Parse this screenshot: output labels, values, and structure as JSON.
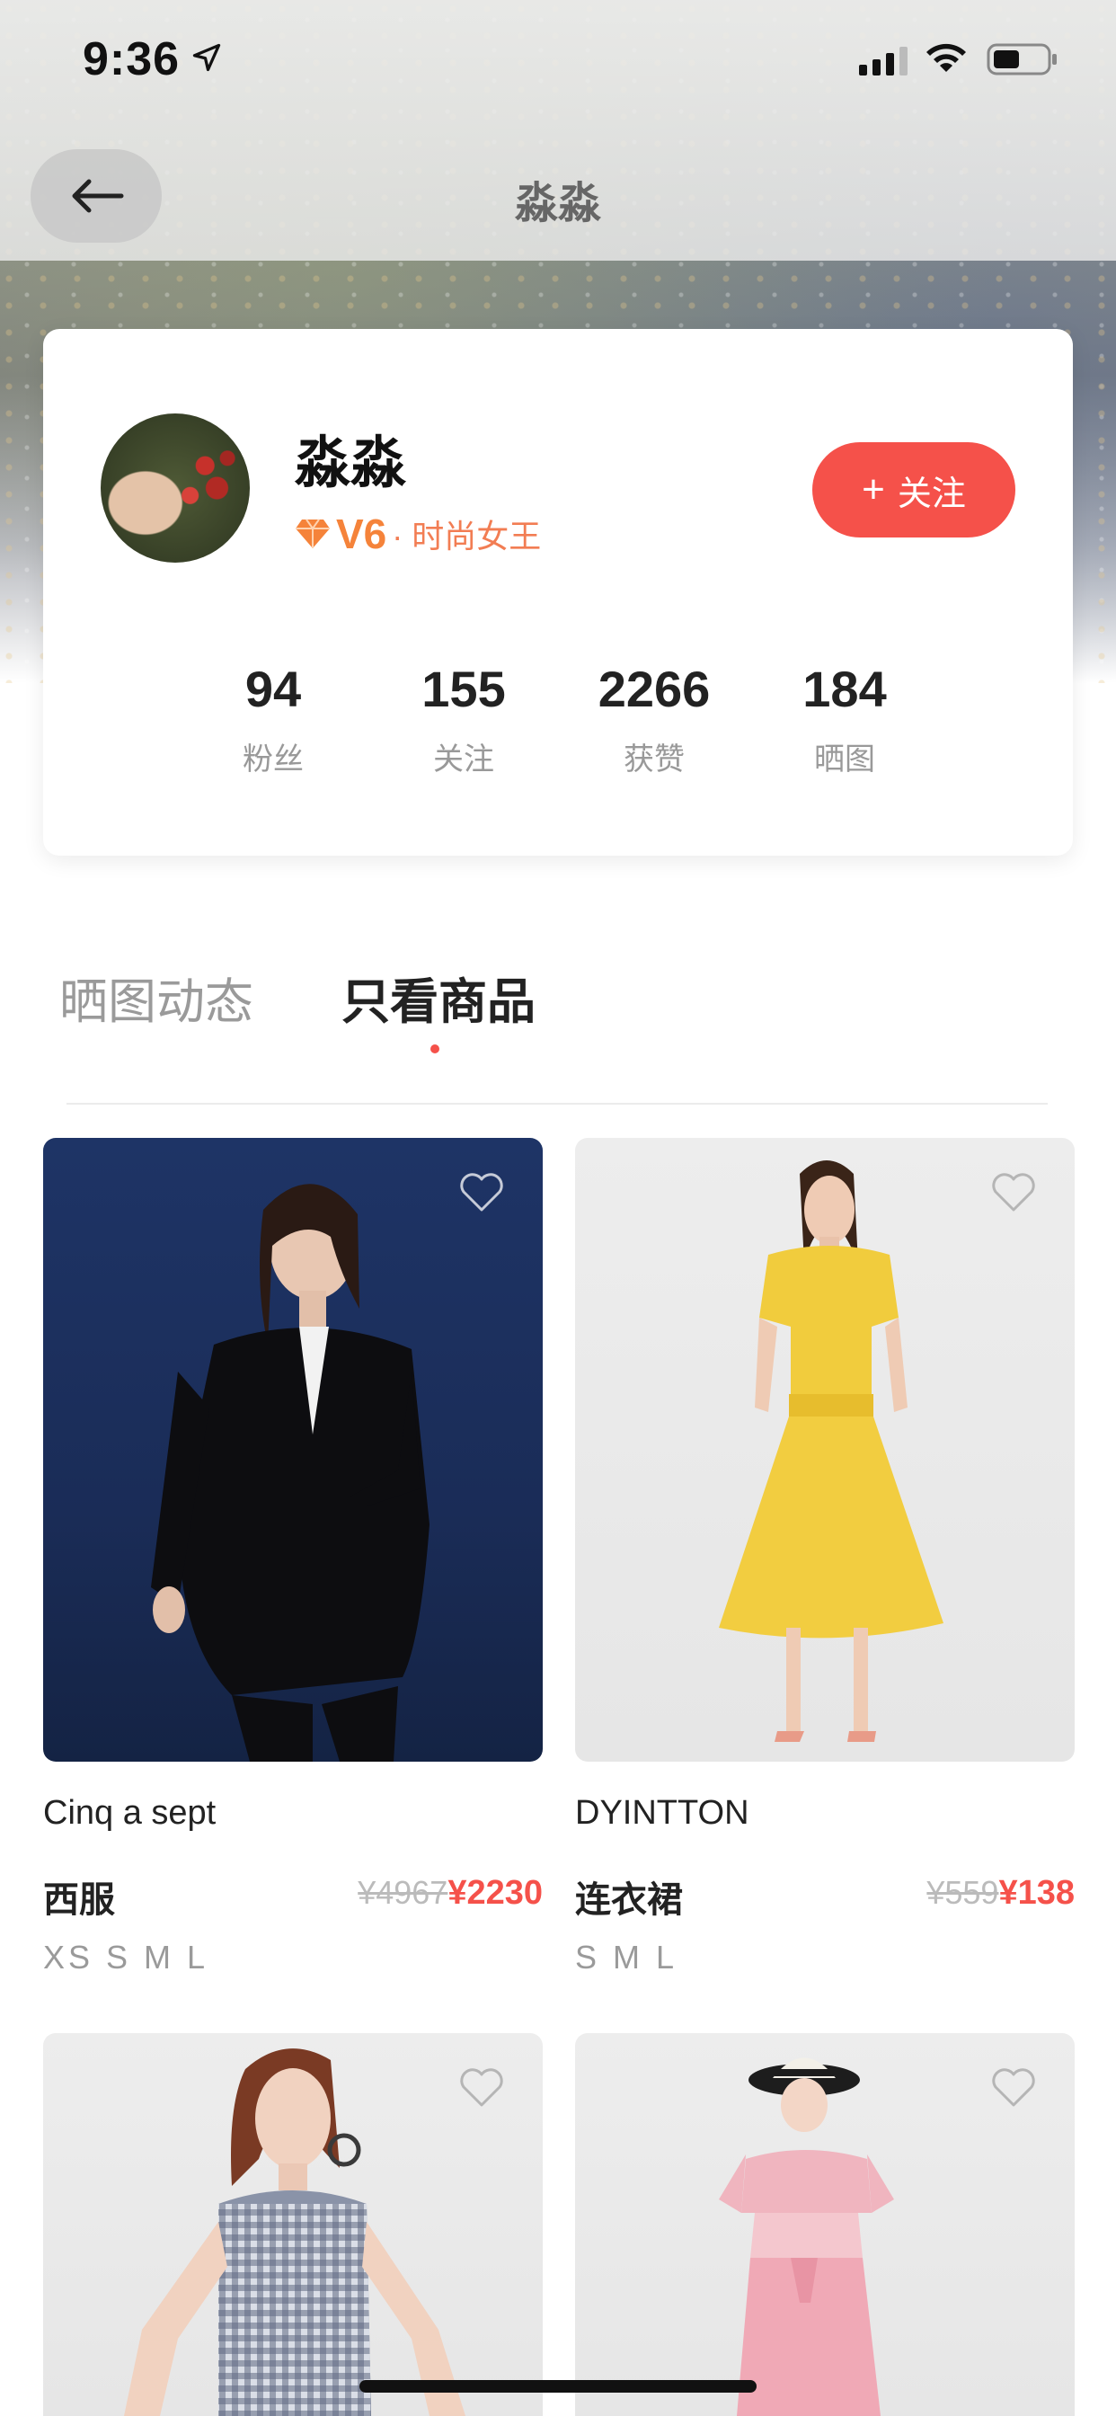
{
  "status_bar": {
    "time": "9:36"
  },
  "nav": {
    "title": "淼淼"
  },
  "profile": {
    "name": "淼淼",
    "level": "V6",
    "level_title": "· 时尚女王",
    "follow_label": "关注"
  },
  "stats": [
    {
      "value": "94",
      "label": "粉丝"
    },
    {
      "value": "155",
      "label": "关注"
    },
    {
      "value": "2266",
      "label": "获赞"
    },
    {
      "value": "184",
      "label": "晒图"
    }
  ],
  "tabs": [
    {
      "label": "晒图动态",
      "active": false
    },
    {
      "label": "只看商品",
      "active": true
    }
  ],
  "products": [
    {
      "brand": "Cinq a sept",
      "name": "西服",
      "old_price": "¥4967",
      "price": "¥2230",
      "sizes": "XS S M L"
    },
    {
      "brand": "DYINTTON",
      "name": "连衣裙",
      "old_price": "¥559",
      "price": "¥138",
      "sizes": "S M L"
    }
  ],
  "colors": {
    "accent": "#f5514a",
    "level": "#f5833a"
  }
}
